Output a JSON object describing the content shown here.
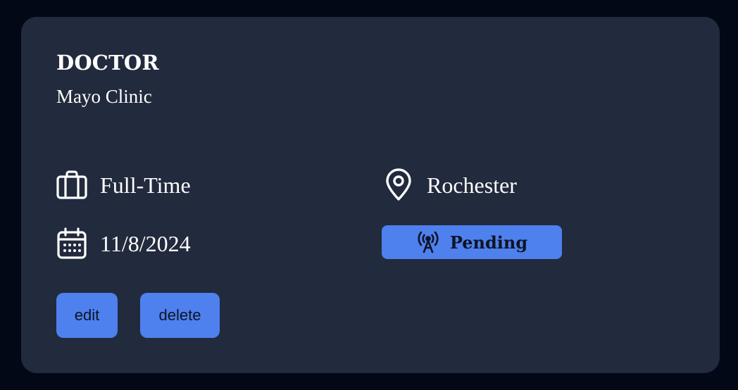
{
  "job": {
    "position": "DOCTOR",
    "company": "Mayo Clinic",
    "job_type": "Full-Time",
    "location": "Rochester",
    "date": "11/8/2024",
    "status": "Pending"
  },
  "actions": {
    "edit_label": "edit",
    "delete_label": "delete"
  },
  "icons": {
    "job_type": "briefcase-icon",
    "location": "map-pin-icon",
    "date": "calendar-icon",
    "status": "broadcast-tower-icon"
  },
  "colors": {
    "page_background": "#020816",
    "card_background": "#222a3d",
    "accent": "#4e80ee",
    "text": "#ffffff",
    "button_text": "#0d1424"
  }
}
